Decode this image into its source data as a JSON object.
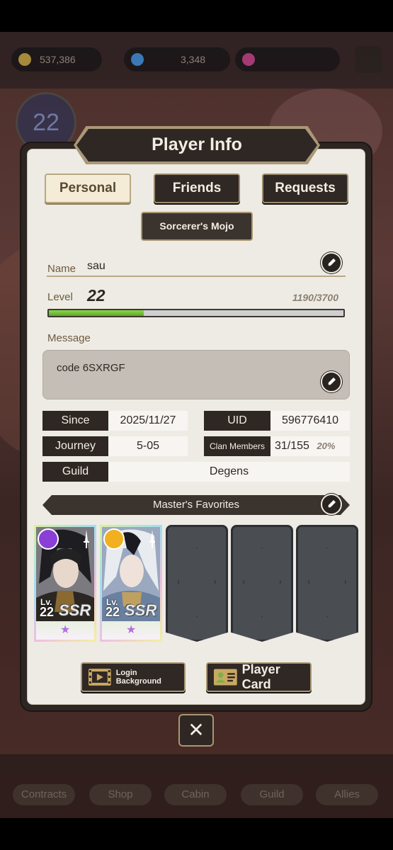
{
  "background": {
    "resources": [
      {
        "value": "537,386",
        "icon": "gold-coin-icon"
      },
      {
        "value": "3,348",
        "icon": "blue-gem-icon"
      },
      {
        "value": "",
        "icon": "pink-gem-icon"
      }
    ],
    "level": "22",
    "nav": [
      "Contracts",
      "Shop",
      "Cabin",
      "Guild",
      "Allies"
    ]
  },
  "title": "Player Info",
  "tabs": {
    "personal": "Personal",
    "friends": "Friends",
    "requests": "Requests"
  },
  "badge": "Sorcerer's Mojo",
  "profile": {
    "name_label": "Name",
    "name": "sau",
    "level_label": "Level",
    "level": "22",
    "xp_text": "1190/3700",
    "xp_fraction": 0.322,
    "message_label": "Message",
    "message": "code 6SXRGF"
  },
  "info": {
    "since_label": "Since",
    "since": "2025/11/27",
    "uid_label": "UID",
    "uid": "596776410",
    "journey_label": "Journey",
    "journey": "5-05",
    "clan_label": "Clan Members",
    "clan": "31/155",
    "clan_pct": "20%",
    "guild_label": "Guild",
    "guild": "Degens"
  },
  "favorites": {
    "title": "Master's Favorites",
    "cards": [
      {
        "lv_label": "Lv.",
        "level": "22",
        "rarity": "SSR",
        "element_color": "#8a3fd6"
      },
      {
        "lv_label": "Lv.",
        "level": "22",
        "rarity": "SSR",
        "element_color": "#f0b020"
      }
    ],
    "empty_slots": 3
  },
  "buttons": {
    "login_bg": "Login Background",
    "player_card": "Player Card",
    "close": "✕"
  },
  "colors": {
    "panel_dark": "#2e2723",
    "panel_light": "#eeebe4",
    "accent_gold": "#a89672",
    "xp_green": "#6cbf33"
  }
}
